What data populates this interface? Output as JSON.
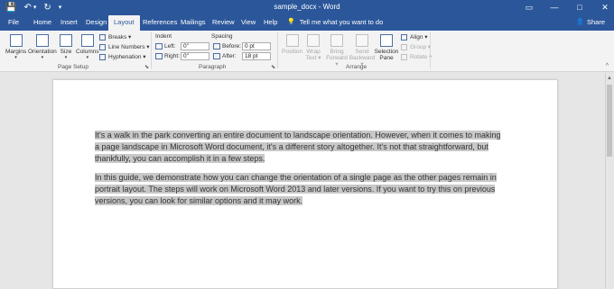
{
  "titlebar": {
    "doc_name": "sample_docx",
    "separator": " - ",
    "app_name": "Word",
    "save_icon": "💾",
    "undo_icon": "↶",
    "undo_menu": "▾",
    "redo_icon": "↻",
    "customize_icon": "▾",
    "restore_icon": "▭",
    "minimize_icon": "—",
    "maximize_icon": "□",
    "close_icon": "✕"
  },
  "tabs": [
    "File",
    "Home",
    "Insert",
    "Design",
    "Layout",
    "References",
    "Mailings",
    "Review",
    "View",
    "Help"
  ],
  "active_tab": "Layout",
  "tell_me": {
    "icon": "💡",
    "text": "Tell me what you want to do"
  },
  "share": {
    "icon": "👤",
    "label": "Share"
  },
  "ribbon": {
    "page_setup": {
      "label": "Page Setup",
      "margins": "Margins",
      "orientation": "Orientation",
      "size": "Size",
      "columns": "Columns",
      "breaks": "Breaks ▾",
      "line_numbers": "Line Numbers ▾",
      "hyphenation": "Hyphenation ▾"
    },
    "paragraph": {
      "label": "Paragraph",
      "indent_head": "Indent",
      "spacing_head": "Spacing",
      "left_label": "Left:",
      "left_value": "0\"",
      "right_label": "Right:",
      "right_value": "0\"",
      "before_label": "Before:",
      "before_value": "0 pt",
      "after_label": "After:",
      "after_value": "18 pt"
    },
    "arrange": {
      "label": "Arrange",
      "position": "Position",
      "wrap_text": "Wrap Text ▾",
      "bring_forward": "Bring Forward ▾",
      "send_backward": "Send Backward ▾",
      "selection_pane": "Selection Pane",
      "align": "Align ▾",
      "group": "Group ▾",
      "rotate": "Rotate ▾"
    },
    "launcher_icon": "⬊",
    "collapse_icon": "^"
  },
  "document": {
    "paragraph1": "It's a walk in the park converting an entire document to landscape orientation. However, when it comes to making a page landscape in Microsoft Word document, it's a different story altogether. It's not that straightforward, but thankfully, you can accomplish it in a few steps.",
    "paragraph2": "In this guide, we demonstrate how you can change the orientation of a single page as the other pages remain in portrait layout. The steps will work on Microsoft Word 2013 and later versions. If you want to try this on previous versions, you can look for similar options and it may work.",
    "highlight_color": "#c8c8c8"
  },
  "colors": {
    "accent": "#2b579a",
    "ribbon_bg": "#f3f3f3",
    "canvas_bg": "#e6e6e6"
  }
}
